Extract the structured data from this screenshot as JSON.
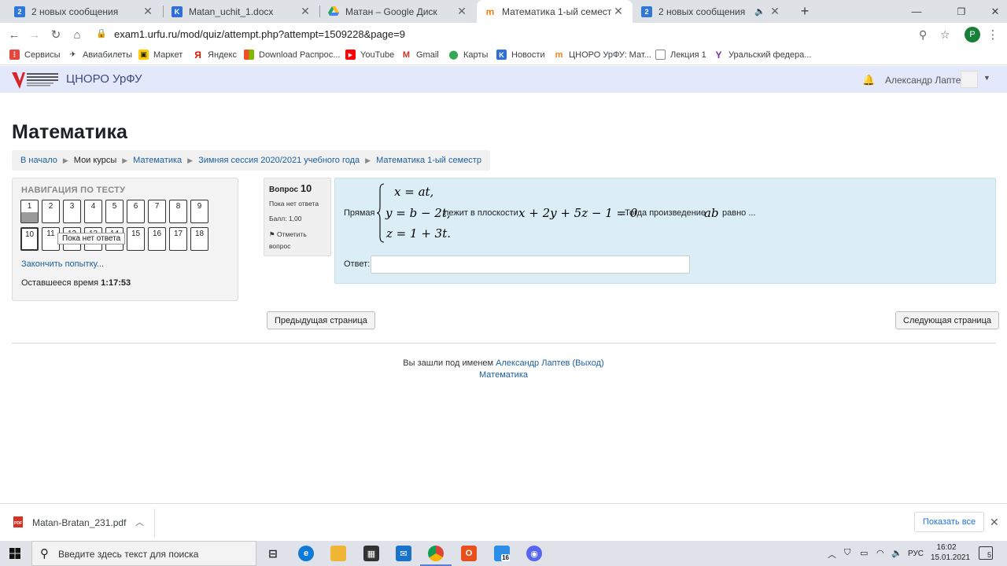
{
  "browser": {
    "tabs": [
      {
        "title": "2 новых сообщения",
        "icon": "vk-badge-icon",
        "badge": "2"
      },
      {
        "title": "Matan_uchit_1.docx",
        "icon": "vk-icon"
      },
      {
        "title": "Матан – Google Диск",
        "icon": "google-drive-icon"
      },
      {
        "title": "Математика 1-ый семестр",
        "icon": "moodle-icon"
      },
      {
        "title": "2 новых сообщения",
        "icon": "vk-badge-icon",
        "badge": "2"
      }
    ],
    "url": "exam1.urfu.ru/mod/quiz/attempt.php?attempt=1509228&page=9",
    "profile_initial": "P",
    "bookmarks": [
      "Сервисы",
      "Авиабилеты",
      "Маркет",
      "Яндекс",
      "Download Распрос...",
      "YouTube",
      "Gmail",
      "Карты",
      "Новости",
      "ЦНОРО УрФУ: Мат...",
      "Лекция 1",
      "Уральский федера..."
    ]
  },
  "site": {
    "name": "ЦНОРО УрФУ",
    "user_name": "Александр Лаптев"
  },
  "page": {
    "title": "Математика",
    "breadcrumb": [
      "В начало",
      "Мои курсы",
      "Математика",
      "Зимняя сессия 2020/2021 учебного года",
      "Математика 1-ый семестр"
    ]
  },
  "quiz_nav": {
    "title": "НАВИГАЦИЯ ПО ТЕСТУ",
    "row1": [
      "1",
      "2",
      "3",
      "4",
      "5",
      "6",
      "7",
      "8",
      "9"
    ],
    "row2": [
      "10",
      "11",
      "12",
      "13",
      "14",
      "15",
      "16",
      "17",
      "18"
    ],
    "tooltip": "Пока нет ответа",
    "finish_link": "Закончить попытку...",
    "time_label": "Оставшееся время",
    "time_value": "1:17:53"
  },
  "question": {
    "label": "Вопрос",
    "number": "10",
    "status": "Пока нет ответа",
    "score": "Балл: 1,00",
    "flag": "Отметить вопрос",
    "text_intro": "Прямая",
    "eq1": "x = at,",
    "eq2": "y = b − 2t,",
    "eq3": "z = 1 + 3t.",
    "text_mid": "лежит в плоскости",
    "plane": "x + 2y + 5z − 1 = 0",
    "text_then": ". Тогда произведение",
    "product": "ab",
    "text_end": "равно ...",
    "answer_label": "Ответ:",
    "answer_value": ""
  },
  "buttons": {
    "prev": "Предыдущая страница",
    "next": "Следующая страница"
  },
  "footer": {
    "logged_in": "Вы зашли под именем",
    "user": "Александр Лаптев",
    "logout": "(Выход)",
    "course": "Математика"
  },
  "downloads": {
    "file": "Matan-Bratan_231.pdf",
    "show_all": "Показать все"
  },
  "taskbar": {
    "search_placeholder": "Введите здесь текст для поиска",
    "badge_count": "16",
    "lang": "РУС",
    "time": "16:02",
    "date": "15.01.2021",
    "notif_count": "5"
  }
}
